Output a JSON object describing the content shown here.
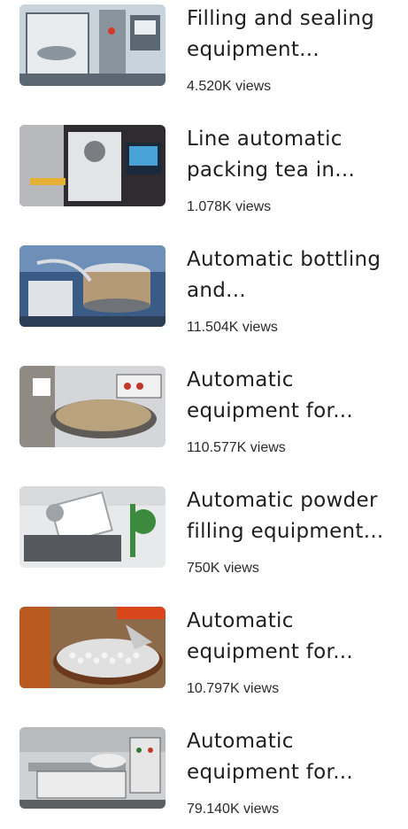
{
  "videos": [
    {
      "title": "Filling and sealing equipment...",
      "views": "4.520K views",
      "thumb_icon": "filling-machine-photo",
      "palette": {
        "bg": "#c8d3dc",
        "a": "#8a949c",
        "b": "#e7ebee",
        "c": "#5b6772",
        "accent": "#d23a2a"
      }
    },
    {
      "title": "Line automatic packing tea in...",
      "views": "1.078K views",
      "thumb_icon": "tea-packing-machine-photo",
      "palette": {
        "bg": "#2f2c30",
        "a": "#b7b9bd",
        "b": "#e3e4e6",
        "c": "#7a7d82",
        "accent": "#c8322a"
      }
    },
    {
      "title": "Automatic bottling and...",
      "views": "11.504K views",
      "thumb_icon": "bottling-machine-photo",
      "palette": {
        "bg": "#3a5b86",
        "a": "#b59a78",
        "b": "#d9dde2",
        "c": "#6f7377",
        "accent": "#2b6fc4"
      }
    },
    {
      "title": "Automatic equipment for...",
      "views": "110.577K views",
      "thumb_icon": "rotary-equipment-photo",
      "palette": {
        "bg": "#d4d6da",
        "a": "#8f8a84",
        "b": "#f0f0f0",
        "c": "#5e5a56",
        "accent": "#c0392b"
      }
    },
    {
      "title": "Automatic powder filling equipment...",
      "views": "750K views",
      "thumb_icon": "powder-filling-machine-photo",
      "palette": {
        "bg": "#e8e9ea",
        "a": "#9ea3a8",
        "b": "#ffffff",
        "c": "#55595d",
        "accent": "#3b8a3e"
      }
    },
    {
      "title": "Automatic equipment for...",
      "views": "10.797K views",
      "thumb_icon": "bottle-sorting-machine-photo",
      "palette": {
        "bg": "#b85a1f",
        "a": "#e0e0e0",
        "b": "#f4f4f4",
        "c": "#6b3a1e",
        "accent": "#d9461b"
      }
    },
    {
      "title": "Automatic equipment for...",
      "views": "79.140K views",
      "thumb_icon": "conveyor-equipment-photo",
      "palette": {
        "bg": "#cfd2d4",
        "a": "#9a9d9f",
        "b": "#ececec",
        "c": "#5c5f62",
        "accent": "#2f7a3a"
      }
    }
  ]
}
